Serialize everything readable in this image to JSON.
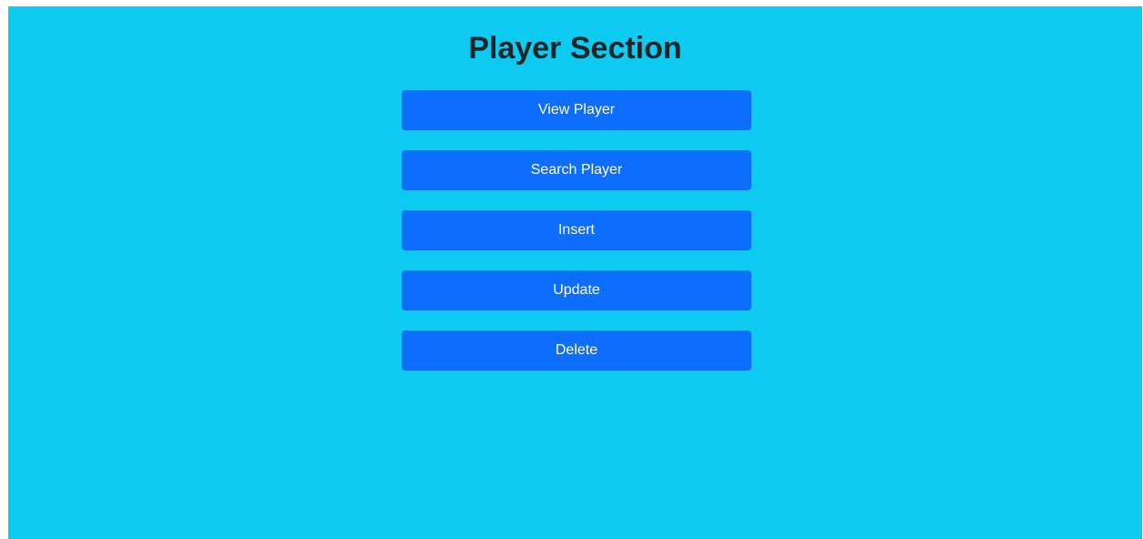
{
  "page": {
    "title": "Player Section",
    "background_color": "#0dcaf0",
    "button_color": "#0d6efd"
  },
  "menu": {
    "buttons": [
      {
        "label": "View Player"
      },
      {
        "label": "Search Player"
      },
      {
        "label": "Insert"
      },
      {
        "label": "Update"
      },
      {
        "label": "Delete"
      }
    ]
  }
}
